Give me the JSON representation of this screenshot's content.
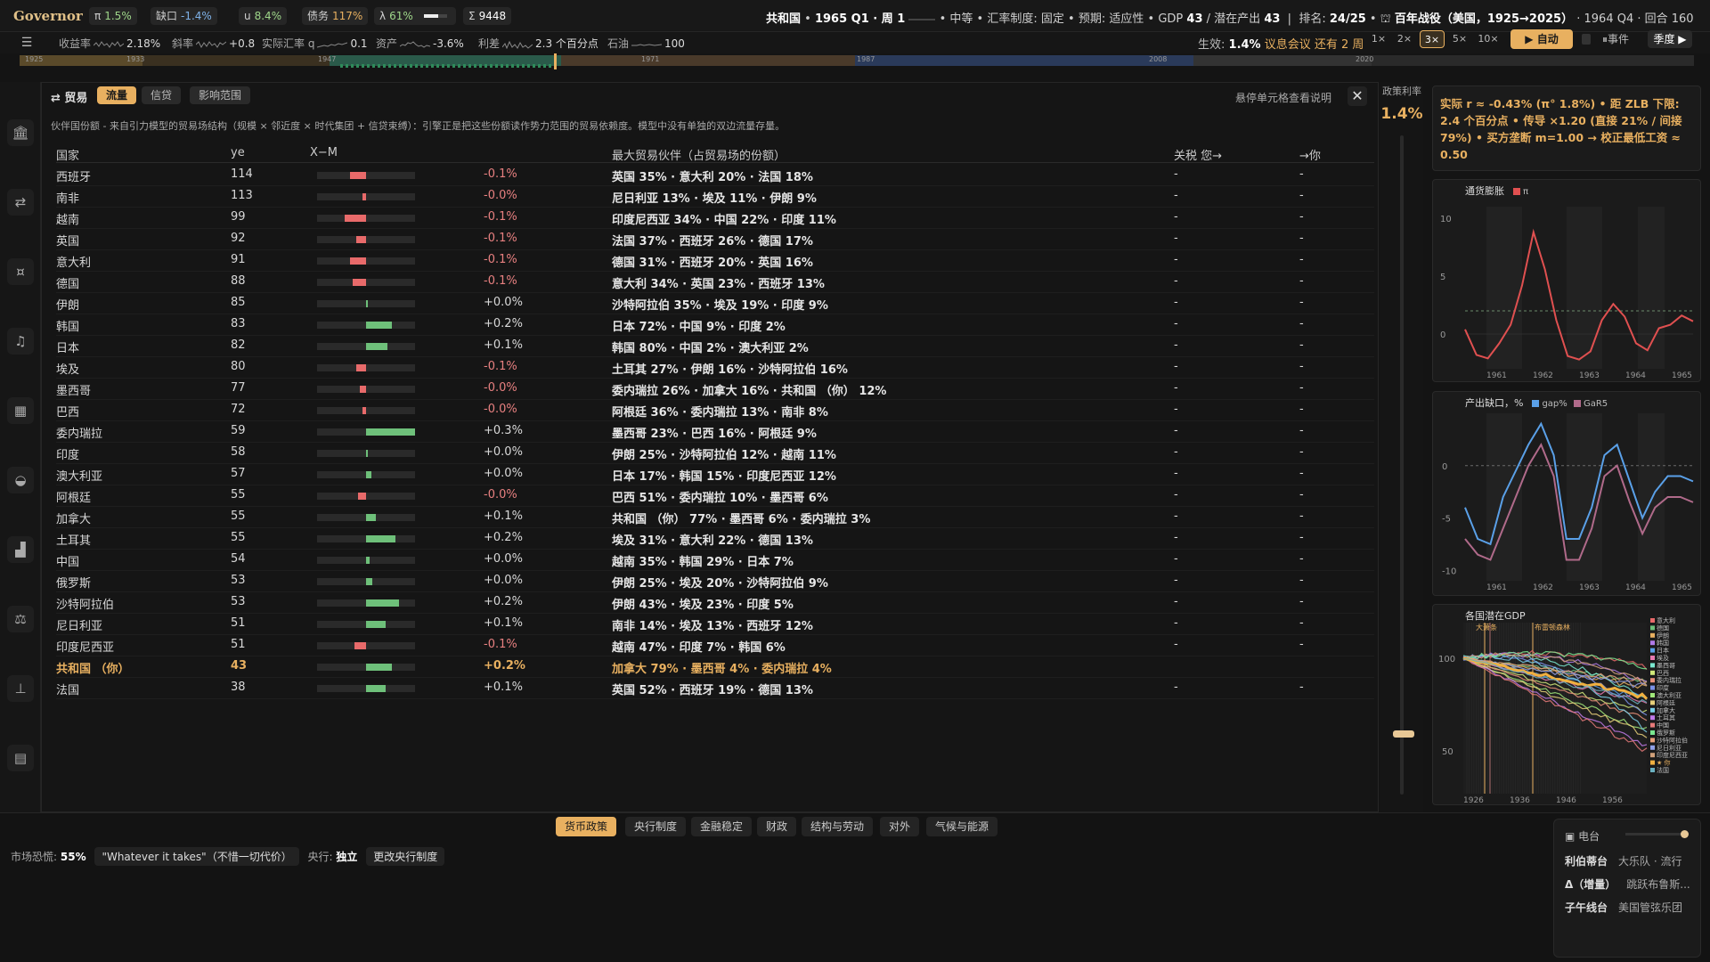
{
  "app": {
    "brand": "Governor"
  },
  "top": {
    "chips": [
      {
        "label": "π",
        "value": "1.5%",
        "cls": "grn"
      },
      {
        "label": "缺口",
        "value": "-1.4%",
        "cls": "blu"
      },
      {
        "label": "u",
        "value": "8.4%",
        "cls": "grn"
      },
      {
        "label": "债务",
        "value": "117%",
        "cls": "amb"
      },
      {
        "label": "λ",
        "value": "61%",
        "cls": "grn"
      },
      {
        "label": "Σ",
        "value": "9448",
        "cls": ""
      }
    ],
    "country": "共和国",
    "quarter": "1965 Q1 · 周 1",
    "level": "中等",
    "fx_label": "汇率制度:",
    "fx_value": "固定",
    "expect_label": "预期:",
    "expect_value": "适应性",
    "gdp_label": "GDP",
    "gdp_value": "43",
    "potential_label": "潜在产出",
    "potential_value": "43",
    "rank_label": "排名:",
    "rank_value": "24/25",
    "campaign": "百年战役（美国，1925→2025）",
    "season": "1964 Q4 · 回合 160"
  },
  "indicators": [
    {
      "label": "收益率",
      "value": "2.18%",
      "cls": ""
    },
    {
      "label": "斜率",
      "value": "+0.8",
      "cls": "grn"
    },
    {
      "label": "实际汇率 q",
      "value": "0.1",
      "cls": "blu"
    },
    {
      "label": "资产",
      "value": "-3.6%",
      "cls": "blu"
    },
    {
      "label": "利差",
      "value": "2.3 个百分点",
      "cls": ""
    },
    {
      "label": "石油",
      "value": "100",
      "cls": ""
    }
  ],
  "effect": {
    "prefix": "生效:",
    "rate": "1.4%",
    "meeting": "议息会议 还有 2 周"
  },
  "speed": {
    "options": [
      "1×",
      "2×",
      "3×",
      "5×",
      "10×"
    ],
    "active": "3×",
    "auto": "自动",
    "events": "事件",
    "quarterly": "季度 ▶"
  },
  "timeline": {
    "labels": [
      "1925",
      "1933",
      "1947",
      "1971",
      "1987",
      "2008",
      "2020"
    ]
  },
  "panel": {
    "title": "⇄ 贸易",
    "tabs": [
      "流量",
      "信贷",
      "影响范围"
    ],
    "active_tab": "流量",
    "hint": "悬停单元格查看说明",
    "close": "✕",
    "desc": "伙伴国份额 - 来自引力模型的贸易场结构（规模 × 邻近度 × 时代集团 + 信贷束缚）：引擎正是把这些份额读作势力范围的贸易依赖度。模型中没有单独的双边流量存量。",
    "headers": {
      "country": "国家",
      "ye": "ye",
      "xm": "X−M",
      "partners": "最大贸易伙伴（占贸易场的份额）",
      "tariff": "关税 您→",
      "you": "→你"
    },
    "rows": [
      {
        "country": "西班牙",
        "ye": "114",
        "xm": -0.1,
        "xm_text": "-0.1%",
        "partners": "英国 35% · 意大利 20% · 法国 18%",
        "tariff": "-",
        "you": "-"
      },
      {
        "country": "南非",
        "ye": "113",
        "xm": -0.02,
        "xm_text": "-0.0%",
        "partners": "尼日利亚 13% · 埃及 11% · 伊朗 9%",
        "tariff": "-",
        "you": "-"
      },
      {
        "country": "越南",
        "ye": "99",
        "xm": -0.13,
        "xm_text": "-0.1%",
        "partners": "印度尼西亚 34% · 中国 22% · 印度 11%",
        "tariff": "-",
        "you": "-"
      },
      {
        "country": "英国",
        "ye": "92",
        "xm": -0.06,
        "xm_text": "-0.1%",
        "partners": "法国 37% · 西班牙 26% · 德国 17%",
        "tariff": "-",
        "you": "-"
      },
      {
        "country": "意大利",
        "ye": "91",
        "xm": -0.1,
        "xm_text": "-0.1%",
        "partners": "德国 31% · 西班牙 20% · 英国 16%",
        "tariff": "-",
        "you": "-"
      },
      {
        "country": "德国",
        "ye": "88",
        "xm": -0.08,
        "xm_text": "-0.1%",
        "partners": "意大利 34% · 英国 23% · 西班牙 13%",
        "tariff": "-",
        "you": "-"
      },
      {
        "country": "伊朗",
        "ye": "85",
        "xm": 0.01,
        "xm_text": "+0.0%",
        "partners": "沙特阿拉伯 35% · 埃及 19% · 印度 9%",
        "tariff": "-",
        "you": "-"
      },
      {
        "country": "韩国",
        "ye": "83",
        "xm": 0.16,
        "xm_text": "+0.2%",
        "partners": "日本 72% · 中国 9% · 印度 2%",
        "tariff": "-",
        "you": "-"
      },
      {
        "country": "日本",
        "ye": "82",
        "xm": 0.13,
        "xm_text": "+0.1%",
        "partners": "韩国 80% · 中国 2% · 澳大利亚 2%",
        "tariff": "-",
        "you": "-"
      },
      {
        "country": "埃及",
        "ye": "80",
        "xm": -0.06,
        "xm_text": "-0.1%",
        "partners": "土耳其 27% · 伊朗 16% · 沙特阿拉伯 16%",
        "tariff": "-",
        "you": "-"
      },
      {
        "country": "墨西哥",
        "ye": "77",
        "xm": -0.04,
        "xm_text": "-0.0%",
        "partners": "委内瑞拉 26% · 加拿大 16% · 共和国 （你） 12%",
        "tariff": "-",
        "you": "-"
      },
      {
        "country": "巴西",
        "ye": "72",
        "xm": -0.02,
        "xm_text": "-0.0%",
        "partners": "阿根廷 36% · 委内瑞拉 13% · 南非 8%",
        "tariff": "-",
        "you": "-"
      },
      {
        "country": "委内瑞拉",
        "ye": "59",
        "xm": 0.3,
        "xm_text": "+0.3%",
        "partners": "墨西哥 23% · 巴西 16% · 阿根廷 9%",
        "tariff": "-",
        "you": "-"
      },
      {
        "country": "印度",
        "ye": "58",
        "xm": 0.01,
        "xm_text": "+0.0%",
        "partners": "伊朗 25% · 沙特阿拉伯 12% · 越南 11%",
        "tariff": "-",
        "you": "-"
      },
      {
        "country": "澳大利亚",
        "ye": "57",
        "xm": 0.03,
        "xm_text": "+0.0%",
        "partners": "日本 17% · 韩国 15% · 印度尼西亚 12%",
        "tariff": "-",
        "you": "-"
      },
      {
        "country": "阿根廷",
        "ye": "55",
        "xm": -0.05,
        "xm_text": "-0.0%",
        "partners": "巴西 51% · 委内瑞拉 10% · 墨西哥 6%",
        "tariff": "-",
        "you": "-"
      },
      {
        "country": "加拿大",
        "ye": "55",
        "xm": 0.06,
        "xm_text": "+0.1%",
        "partners": "共和国 （你） 77% · 墨西哥 6% · 委内瑞拉 3%",
        "tariff": "-",
        "you": "-"
      },
      {
        "country": "土耳其",
        "ye": "55",
        "xm": 0.18,
        "xm_text": "+0.2%",
        "partners": "埃及 31% · 意大利 22% · 德国 13%",
        "tariff": "-",
        "you": "-"
      },
      {
        "country": "中国",
        "ye": "54",
        "xm": 0.02,
        "xm_text": "+0.0%",
        "partners": "越南 35% · 韩国 29% · 日本 7%",
        "tariff": "-",
        "you": "-"
      },
      {
        "country": "俄罗斯",
        "ye": "53",
        "xm": 0.04,
        "xm_text": "+0.0%",
        "partners": "伊朗 25% · 埃及 20% · 沙特阿拉伯 9%",
        "tariff": "-",
        "you": "-"
      },
      {
        "country": "沙特阿拉伯",
        "ye": "53",
        "xm": 0.2,
        "xm_text": "+0.2%",
        "partners": "伊朗 43% · 埃及 23% · 印度 5%",
        "tariff": "-",
        "you": "-"
      },
      {
        "country": "尼日利亚",
        "ye": "51",
        "xm": 0.12,
        "xm_text": "+0.1%",
        "partners": "南非 14% · 埃及 13% · 西班牙 12%",
        "tariff": "-",
        "you": "-"
      },
      {
        "country": "印度尼西亚",
        "ye": "51",
        "xm": -0.07,
        "xm_text": "-0.1%",
        "partners": "越南 47% · 印度 7% · 韩国 6%",
        "tariff": "-",
        "you": "-"
      },
      {
        "country": "共和国 （你）",
        "ye": "43",
        "xm": 0.16,
        "xm_text": "+0.2%",
        "partners": "加拿大 79% · 墨西哥 4% · 委内瑞拉 4%",
        "tariff": "",
        "you": "",
        "is_you": true
      },
      {
        "country": "法国",
        "ye": "38",
        "xm": 0.12,
        "xm_text": "+0.1%",
        "partners": "英国 52% · 西班牙 19% · 德国 13%",
        "tariff": "-",
        "you": "-"
      }
    ]
  },
  "policy_rail": {
    "label": "政策利率",
    "value": "1.4%",
    "level": 0.12
  },
  "right": {
    "message": "实际 r ≈ -0.43% (π° 1.8%) • 距 ZLB 下限: 2.4 个百分点 • 传导 ×1.20 (直接 21% / 间接 79%) • 买方垄断 m=1.00 → 校正最低工资 ≈ 0.50",
    "inflation": {
      "title": "通货膨胀",
      "legend": "π",
      "years": [
        "1961",
        "1962",
        "1963",
        "1964",
        "1965"
      ],
      "ticks": [
        "10",
        "5",
        "0"
      ],
      "values": [
        0.4,
        -1.8,
        -2.1,
        -0.8,
        0.8,
        4.2,
        8.8,
        5.6,
        1.2,
        -1.9,
        -2.2,
        -1.5,
        1.2,
        2.6,
        1.5,
        -0.8,
        -1.4,
        0.5,
        0.8,
        1.6,
        1.1
      ],
      "target": 2.0
    },
    "gap": {
      "title": "产出缺口，%",
      "legend1": "gap%",
      "legend2": "GaR5",
      "years": [
        "1961",
        "1962",
        "1963",
        "1964",
        "1965"
      ],
      "ticks": [
        "0",
        "-5",
        "-10"
      ],
      "gap": [
        -4,
        -7,
        -7.5,
        -3,
        -0.5,
        2,
        4,
        1,
        -7,
        -7,
        -4,
        1,
        2,
        -1.5,
        -5,
        -2.5,
        -1,
        -1,
        -1.5
      ],
      "gar": [
        -7,
        -8.5,
        -9,
        -6,
        -3,
        0,
        2,
        -1,
        -9,
        -9,
        -6,
        -1,
        0,
        -3.5,
        -6.5,
        -4,
        -3,
        -3,
        -3.5
      ]
    },
    "potential": {
      "title": "各国潜在GDP",
      "events": [
        "大萧条",
        "布雷顿森林"
      ],
      "ticks": [
        "100",
        "50"
      ],
      "years": [
        "1926",
        "1936",
        "1946",
        "1956"
      ],
      "countries": [
        "意大利",
        "德国",
        "伊朗",
        "韩国",
        "日本",
        "埃及",
        "墨西哥",
        "巴西",
        "委内瑞拉",
        "印度",
        "澳大利亚",
        "阿根廷",
        "加拿大",
        "土耳其",
        "中国",
        "俄罗斯",
        "沙特阿拉伯",
        "尼日利亚",
        "印度尼西亚",
        "★ 你",
        "法国"
      ]
    }
  },
  "bottom": {
    "tabs": [
      "货币政策",
      "央行制度",
      "金融稳定",
      "财政",
      "结构与劳动",
      "对外",
      "气候与能源"
    ],
    "active": "货币政策",
    "fear_label": "市场恐慌:",
    "fear_value": "55%",
    "quote": "\"Whatever it takes\"（不惜一切代价）",
    "cb_label": "央行:",
    "cb_value": "独立",
    "change": "更改央行制度",
    "radio": {
      "title": "电台",
      "rows": [
        {
          "a": "利伯蒂台",
          "b": "大乐队 · 流行"
        },
        {
          "a": "Δ（增量）",
          "b": "跳跃布鲁斯..."
        },
        {
          "a": "子午线台",
          "b": "美国管弦乐团"
        }
      ]
    }
  }
}
